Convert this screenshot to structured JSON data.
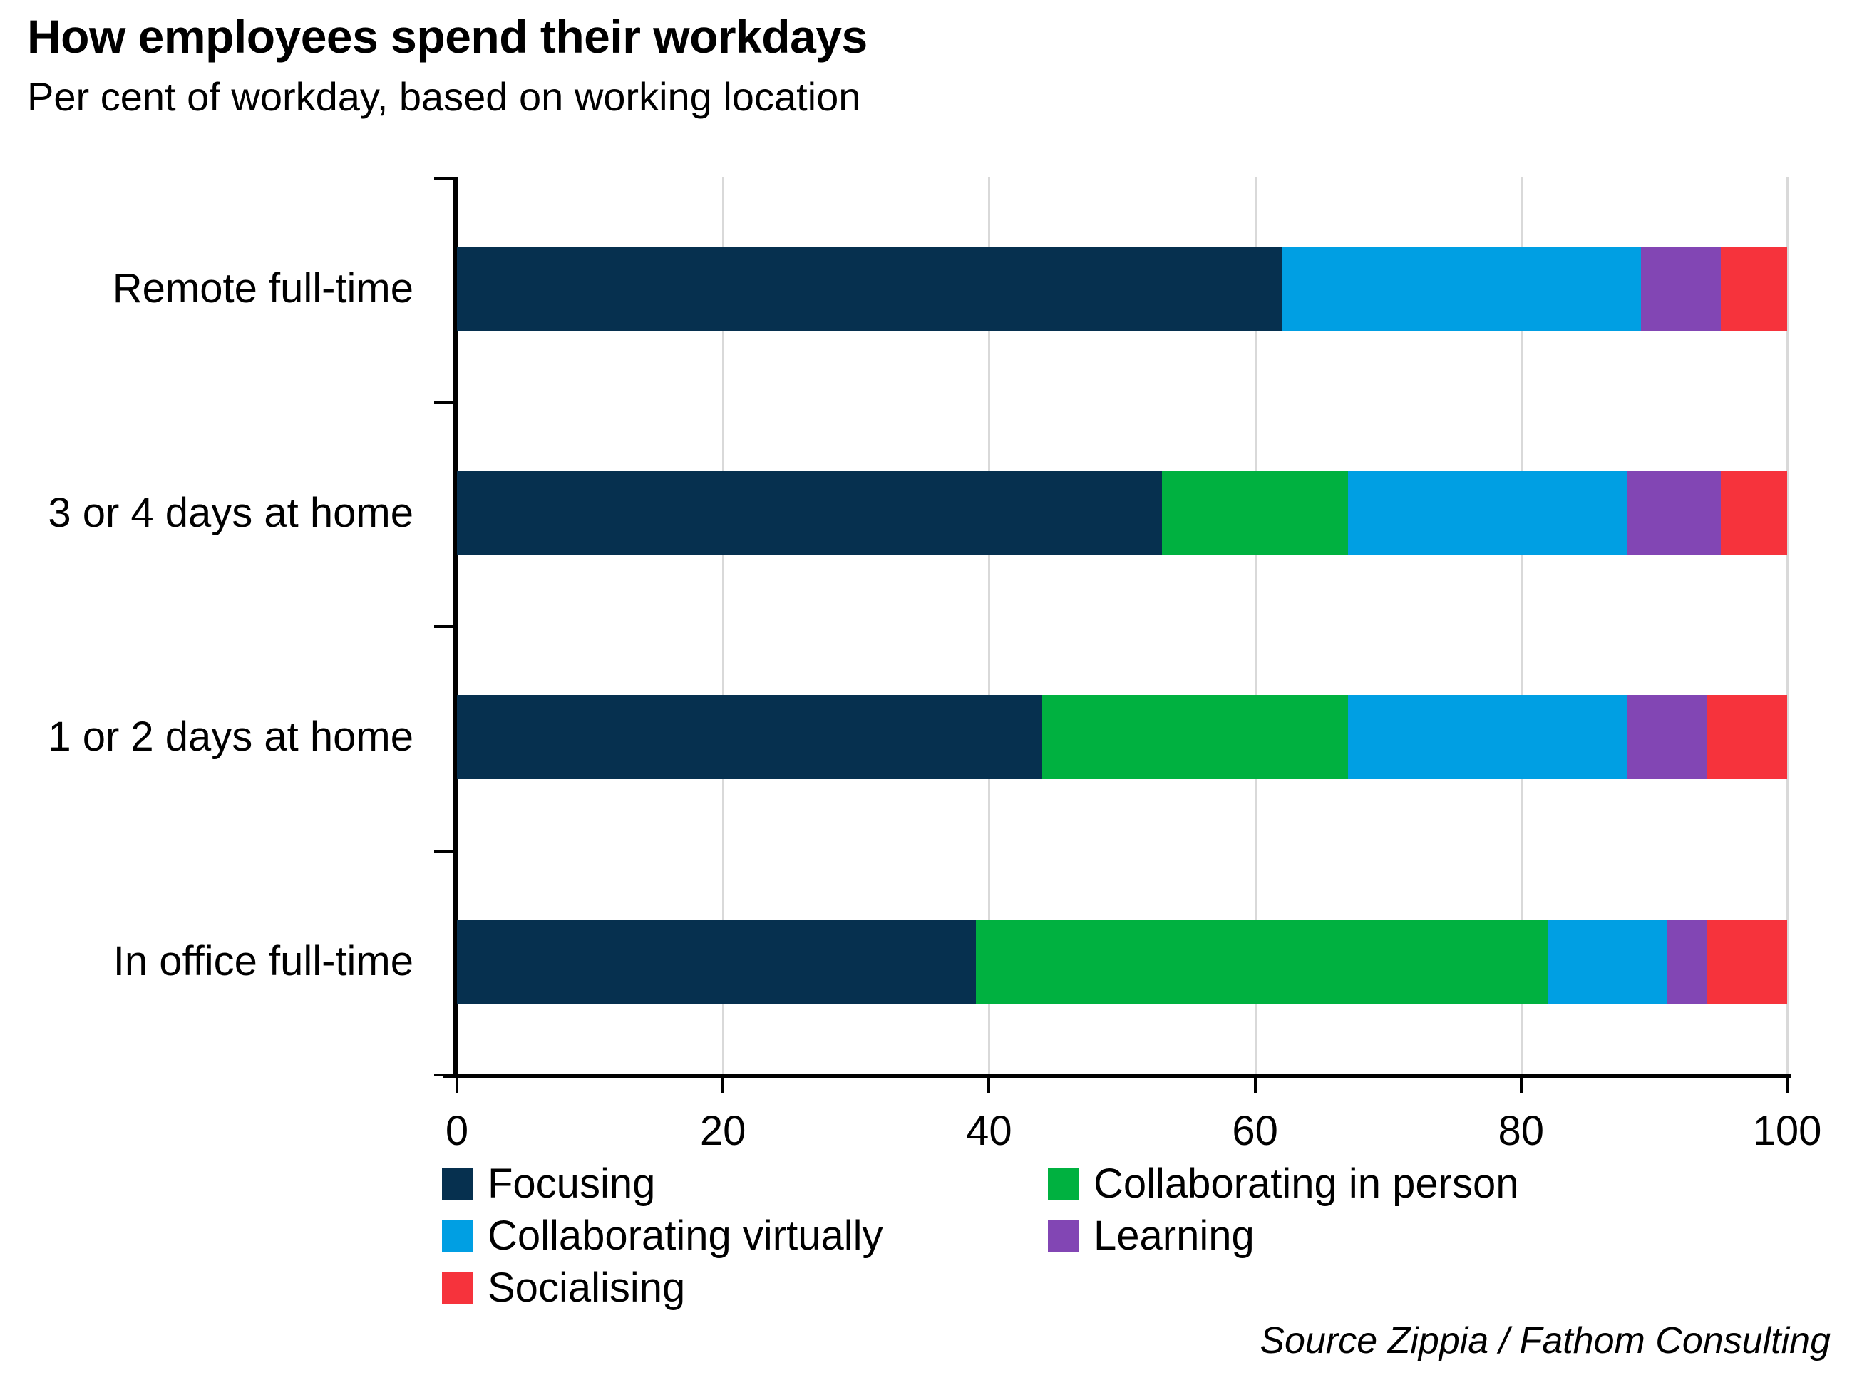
{
  "header": {
    "title": "How employees spend their workdays",
    "subtitle": "Per cent of workday, based on working location"
  },
  "source": "Source Zippia / Fathom Consulting",
  "colors": {
    "focusing": "#06304f",
    "collaborating_in_person": "#00b140",
    "collaborating_virtually": "#009fe3",
    "learning": "#8246b4",
    "socialising": "#f6333c",
    "gridline": "#d9d9d9",
    "axis": "#000000",
    "background": "#ffffff"
  },
  "chart_data": {
    "type": "bar",
    "orientation": "horizontal",
    "stacked": true,
    "title": "How employees spend their workdays",
    "subtitle": "Per cent of workday, based on working location",
    "xlabel": "",
    "ylabel": "",
    "xlim": [
      0,
      100
    ],
    "ylim": [
      0,
      4
    ],
    "grid": true,
    "legend_position": "bottom",
    "xticks": [
      0,
      20,
      40,
      60,
      80,
      100
    ],
    "xtick_labels": [
      "0",
      "20",
      "40",
      "60",
      "80",
      "100"
    ],
    "categories": [
      "Remote full-time",
      "3 or 4 days at home",
      "1 or 2 days at home",
      "In office full-time"
    ],
    "series": [
      {
        "name": "Focusing",
        "color": "#06304f",
        "values": [
          62,
          53,
          44,
          39
        ]
      },
      {
        "name": "Collaborating in person",
        "color": "#00b140",
        "values": [
          0,
          14,
          23,
          43
        ]
      },
      {
        "name": "Collaborating virtually",
        "color": "#009fe3",
        "values": [
          27,
          21,
          21,
          9
        ]
      },
      {
        "name": "Learning",
        "color": "#8246b4",
        "values": [
          6,
          7,
          6,
          3
        ]
      },
      {
        "name": "Socialising",
        "color": "#f6333c",
        "values": [
          5,
          5,
          6,
          6
        ]
      }
    ],
    "legend": [
      {
        "label": "Focusing",
        "color": "#06304f"
      },
      {
        "label": "Collaborating in person",
        "color": "#00b140"
      },
      {
        "label": "Collaborating virtually",
        "color": "#009fe3"
      },
      {
        "label": "Learning",
        "color": "#8246b4"
      },
      {
        "label": "Socialising",
        "color": "#f6333c"
      }
    ]
  }
}
